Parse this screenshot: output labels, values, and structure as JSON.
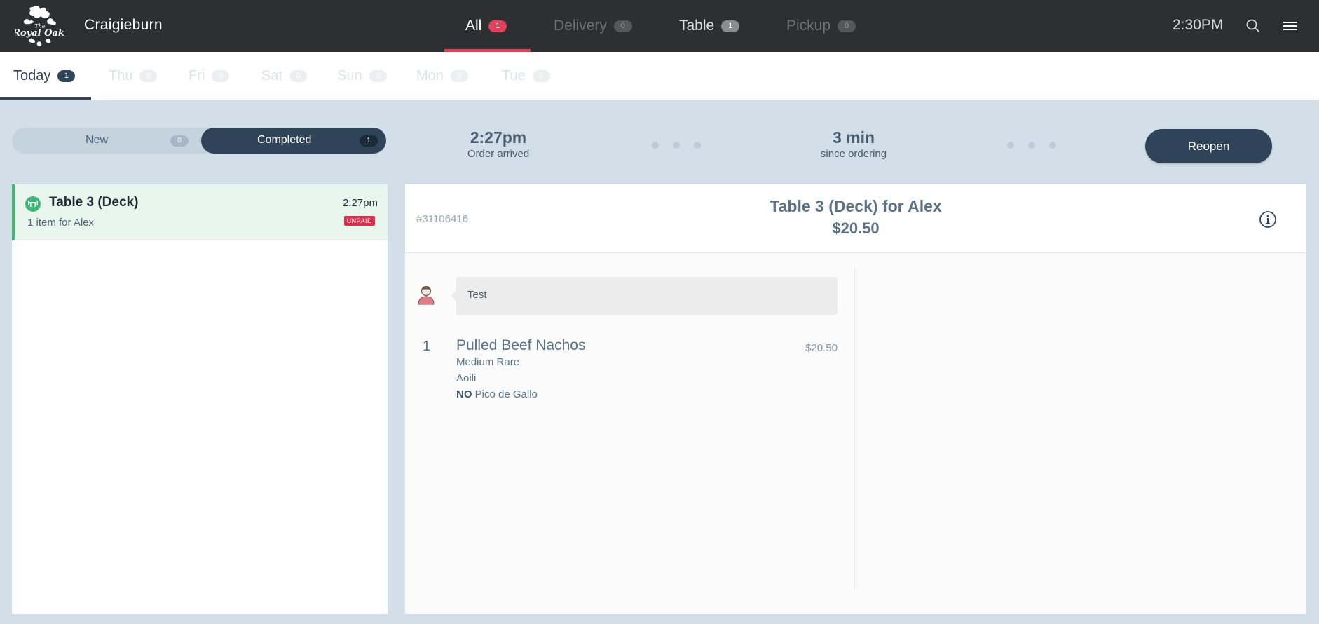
{
  "topbar": {
    "logo_text": "The Royal Oak",
    "store": "Craigieburn",
    "tabs": [
      {
        "label": "All",
        "count": "1"
      },
      {
        "label": "Delivery",
        "count": "0"
      },
      {
        "label": "Table",
        "count": "1"
      },
      {
        "label": "Pickup",
        "count": "0"
      }
    ],
    "time": "2:30PM",
    "icons": {
      "search": "search-icon",
      "menu": "hamburger-menu-icon"
    }
  },
  "days": [
    {
      "label": "Today",
      "count": "1"
    },
    {
      "label": "Thu",
      "count": "0"
    },
    {
      "label": "Fri",
      "count": "0"
    },
    {
      "label": "Sat",
      "count": "0"
    },
    {
      "label": "Sun",
      "count": "0"
    },
    {
      "label": "Mon",
      "count": "0"
    },
    {
      "label": "Tue",
      "count": "0"
    }
  ],
  "status": {
    "new_label": "New",
    "new_count": "0",
    "completed_label": "Completed",
    "completed_count": "1",
    "arrived_time": "2:27pm",
    "arrived_label": "Order arrived",
    "elapsed": "3 min",
    "elapsed_label": "since ordering",
    "reopen_label": "Reopen"
  },
  "orders": [
    {
      "title": "Table 3 (Deck)",
      "subtitle": "1 item for Alex",
      "time": "2:27pm",
      "payment": "UNPAID"
    }
  ],
  "detail": {
    "order_number": "#31106416",
    "title": "Table 3 (Deck) for Alex",
    "total": "$20.50",
    "note": "Test",
    "items": [
      {
        "qty": "1",
        "name": "Pulled Beef Nachos",
        "price": "$20.50",
        "modifiers": [
          {
            "prefix": "",
            "text": "Medium Rare"
          },
          {
            "prefix": "",
            "text": "Aoili"
          },
          {
            "prefix": "NO",
            "text": "Pico de Gallo"
          }
        ]
      }
    ]
  },
  "colors": {
    "accent": "#e3405a",
    "navy": "#2f4458",
    "background": "#d2dee8",
    "table_green": "#3cb873",
    "unpaid_red": "#dd2f4b"
  }
}
